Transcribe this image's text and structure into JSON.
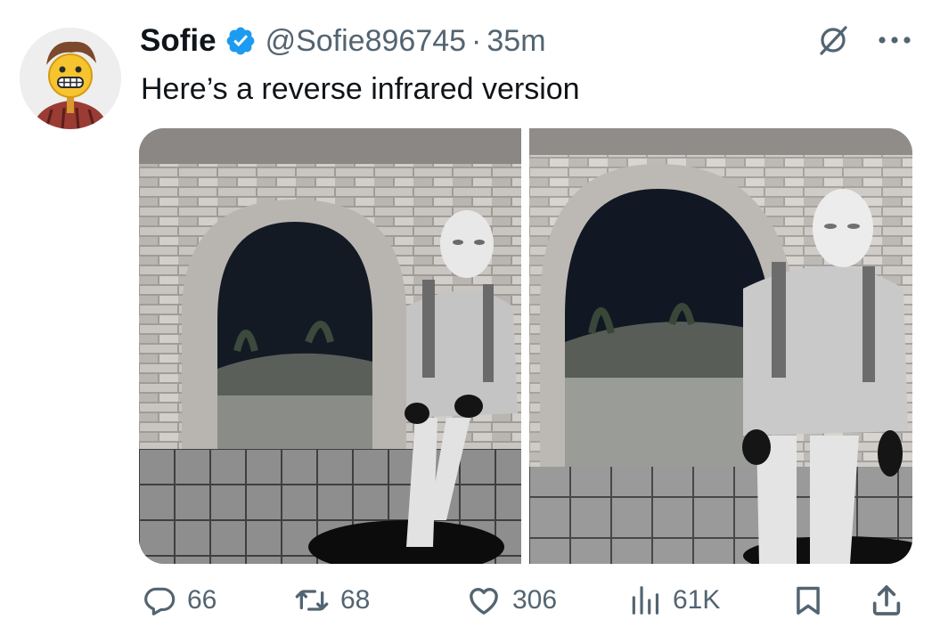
{
  "tweet": {
    "author": {
      "name": "Sofie",
      "handle": "@Sofie896745",
      "verified": true
    },
    "separator": "·",
    "time": "35m",
    "text": "Here’s a reverse infrared version"
  },
  "media": {
    "count": 2,
    "photos": [
      {
        "position": "left"
      },
      {
        "position": "right"
      }
    ]
  },
  "actions": {
    "replies": "66",
    "retweets": "68",
    "likes": "306",
    "views": "61K"
  },
  "icons": {
    "verified": "verified-badge-icon",
    "grok": "grok-icon",
    "more": "more-options-icon",
    "reply": "reply-icon",
    "retweet": "retweet-icon",
    "like": "heart-icon",
    "views": "views-icon",
    "bookmark": "bookmark-icon",
    "share": "share-icon"
  },
  "colors": {
    "text": "#0f1419",
    "secondary": "#536471",
    "verified_blue": "#1d9bf0"
  }
}
